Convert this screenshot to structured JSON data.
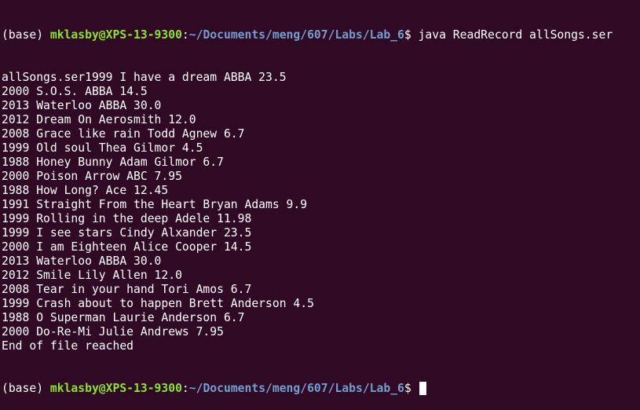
{
  "prompt": {
    "env": "(base) ",
    "user_host": "mklasby@XPS-13-9300",
    "sep": ":",
    "path": "~/Documents/meng/607/Labs/Lab_6",
    "dollar": "$ "
  },
  "command": "java ReadRecord allSongs.ser",
  "output": [
    "allSongs.ser1999 I have a dream ABBA 23.5",
    "2000 S.O.S. ABBA 14.5",
    "2013 Waterloo ABBA 30.0",
    "2012 Dream On Aerosmith 12.0",
    "2008 Grace like rain Todd Agnew 6.7",
    "1999 Old soul Thea Gilmor 4.5",
    "1988 Honey Bunny Adam Gilmor 6.7",
    "2000 Poison Arrow ABC 7.95",
    "1988 How Long? Ace 12.45",
    "1991 Straight From the Heart Bryan Adams 9.9",
    "1999 Rolling in the deep Adele 11.98",
    "1999 I see stars Cindy Alxander 23.5",
    "2000 I am Eighteen Alice Cooper 14.5",
    "2013 Waterloo ABBA 30.0",
    "2012 Smile Lily Allen 12.0",
    "2008 Tear in your hand Tori Amos 6.7",
    "1999 Crash about to happen Brett Anderson 4.5",
    "1988 O Superman Laurie Anderson 6.7",
    "2000 Do-Re-Mi Julie Andrews 7.95",
    "End of file reached"
  ],
  "colors": {
    "background": "#300a24",
    "user_host": "#8ae234",
    "path": "#729fcf",
    "text": "#ffffff"
  }
}
